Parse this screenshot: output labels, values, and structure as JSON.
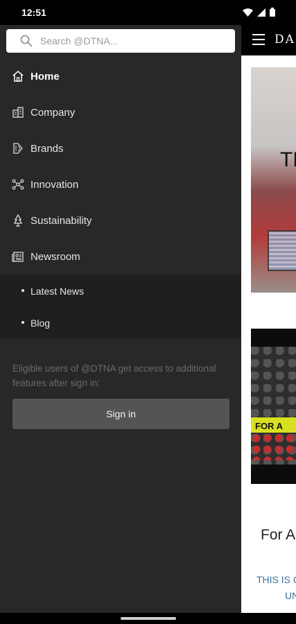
{
  "status": {
    "time": "12:51",
    "icons": [
      "wifi-icon",
      "signal-icon",
      "battery-icon"
    ]
  },
  "drawer": {
    "search": {
      "placeholder": "Search @DTNA..."
    },
    "items": [
      {
        "label": "Home",
        "icon": "home-icon",
        "active": true
      },
      {
        "label": "Company",
        "icon": "building-icon"
      },
      {
        "label": "Brands",
        "icon": "brands-icon"
      },
      {
        "label": "Innovation",
        "icon": "network-icon"
      },
      {
        "label": "Sustainability",
        "icon": "tree-icon"
      },
      {
        "label": "Newsroom",
        "icon": "newspaper-icon"
      }
    ],
    "sub_items": [
      {
        "label": "Latest News"
      },
      {
        "label": "Blog"
      }
    ],
    "signin_note": "Eligible users of @DTNA get access to additional features after sign in:",
    "signin_button": "Sign in"
  },
  "page": {
    "brand": "DA",
    "hero_text": "TH",
    "promo_text": "FOR A",
    "article_title": "For A",
    "article_sub1": "THIS IS C",
    "article_sub2": "UN"
  },
  "colors": {
    "drawer_bg": "#282828",
    "sub_bg": "#1f1f1f",
    "button_bg": "#545454",
    "link_blue": "#3d6fa0"
  }
}
